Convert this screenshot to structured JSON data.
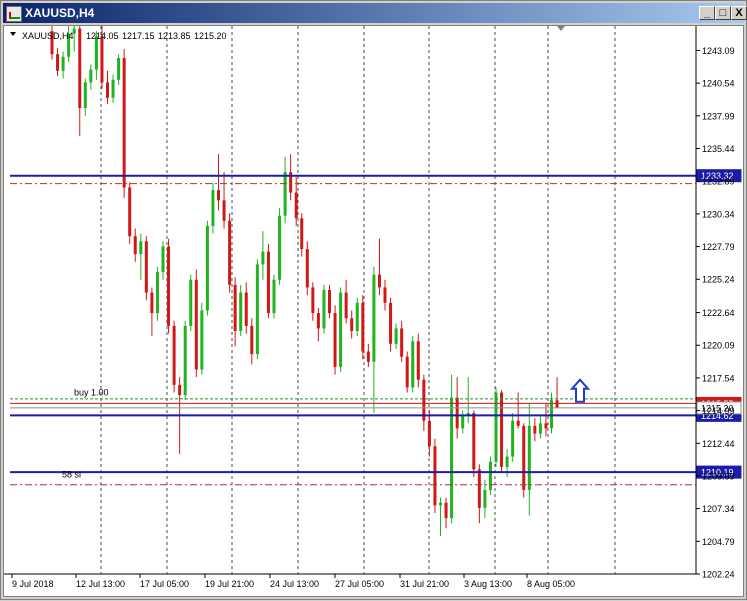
{
  "window": {
    "title": "XAUUSD,H4",
    "controls": {
      "minimize": "_",
      "maximize": "□",
      "close": "X"
    }
  },
  "colors": {
    "bull": "#1fb31f",
    "bear": "#d01818",
    "level_line": "#1c1ca8",
    "dashed_red": "#b03030",
    "vgrid": "#000000",
    "buy_line": "#2e8b2e",
    "arrow": "#1c3ccc"
  },
  "chart_data": {
    "type": "candlestick",
    "header": {
      "symbol": "XAUUSD,H4",
      "open": "1214.05",
      "high": "1217.15",
      "low": "1213.85",
      "close": "1215.20"
    },
    "ylim": [
      1202.24,
      1245.0
    ],
    "yticks": [
      "1243.09",
      "1240.54",
      "1237.99",
      "1235.44",
      "1232.89",
      "1230.34",
      "1227.79",
      "1225.24",
      "1222.64",
      "1220.09",
      "1217.54",
      "1214.99",
      "1212.44",
      "1209.89",
      "1207.34",
      "1204.79",
      "1202.24"
    ],
    "xticks": [
      "9 Jul 2018",
      "12 Jul 13:00",
      "17 Jul 05:00",
      "19 Jul 21:00",
      "24 Jul 13:00",
      "27 Jul 05:00",
      "31 Jul 21:00",
      "3 Aug 13:00",
      "8 Aug 05:00"
    ],
    "grid_vertical": true,
    "grid_horizontal": false,
    "horizontal_levels": [
      {
        "price": 1233.32,
        "label": "1233.32",
        "style": "solid",
        "role": "level"
      },
      {
        "price": 1214.62,
        "label": "1214.62",
        "style": "solid",
        "role": "level"
      },
      {
        "price": 1210.19,
        "label": "1210.19",
        "style": "solid",
        "role": "level"
      },
      {
        "price": 1215.55,
        "label": "1215.55",
        "style": "solid",
        "role": "ask"
      },
      {
        "price": 1215.2,
        "label": "1215.20",
        "style": "solid",
        "role": "bid"
      },
      {
        "price": 1232.7,
        "style": "dashdot",
        "role": "tp"
      },
      {
        "price": 1209.2,
        "style": "dashdot",
        "role": "sl"
      },
      {
        "price": 1215.9,
        "style": "dashed",
        "role": "buy"
      }
    ],
    "annotations": [
      {
        "text": "buy 1.00",
        "price": 1216.4
      },
      {
        "text": "58 sl",
        "price": 1210.0
      }
    ],
    "candles": [
      [
        1244.6,
        1245.2,
        1242.4,
        1242.8
      ],
      [
        1242.8,
        1243.3,
        1241.1,
        1241.5
      ],
      [
        1241.5,
        1243.0,
        1240.9,
        1242.6
      ],
      [
        1242.6,
        1245.0,
        1242.2,
        1244.4
      ],
      [
        1244.4,
        1245.0,
        1243.0,
        1244.8
      ],
      [
        1244.8,
        1245.0,
        1236.4,
        1238.6
      ],
      [
        1238.6,
        1240.9,
        1238.0,
        1240.6
      ],
      [
        1240.6,
        1242.0,
        1240.0,
        1241.6
      ],
      [
        1241.6,
        1244.6,
        1240.8,
        1244.2
      ],
      [
        1244.2,
        1245.0,
        1240.1,
        1240.6
      ],
      [
        1240.6,
        1241.5,
        1238.9,
        1239.4
      ],
      [
        1239.4,
        1241.2,
        1239.0,
        1240.8
      ],
      [
        1240.8,
        1242.8,
        1240.4,
        1242.5
      ],
      [
        1242.5,
        1243.2,
        1231.6,
        1232.4
      ],
      [
        1232.4,
        1232.8,
        1228.0,
        1228.6
      ],
      [
        1228.6,
        1229.2,
        1226.6,
        1227.2
      ],
      [
        1227.2,
        1228.8,
        1225.2,
        1228.2
      ],
      [
        1228.2,
        1228.6,
        1223.6,
        1224.2
      ],
      [
        1224.2,
        1224.6,
        1220.8,
        1222.6
      ],
      [
        1222.6,
        1226.2,
        1222.0,
        1225.8
      ],
      [
        1225.8,
        1228.2,
        1225.2,
        1227.8
      ],
      [
        1227.8,
        1228.4,
        1221.0,
        1221.6
      ],
      [
        1221.6,
        1222.0,
        1216.4,
        1217.0
      ],
      [
        1217.0,
        1217.6,
        1211.6,
        1216.2
      ],
      [
        1216.2,
        1222.0,
        1215.8,
        1221.6
      ],
      [
        1221.6,
        1225.6,
        1221.2,
        1225.2
      ],
      [
        1225.2,
        1226.0,
        1217.6,
        1218.2
      ],
      [
        1218.2,
        1223.4,
        1217.8,
        1222.8
      ],
      [
        1222.8,
        1229.8,
        1222.4,
        1229.4
      ],
      [
        1229.4,
        1232.8,
        1228.8,
        1232.2
      ],
      [
        1232.2,
        1235.0,
        1230.6,
        1231.4
      ],
      [
        1231.4,
        1233.6,
        1229.2,
        1229.8
      ],
      [
        1229.8,
        1230.4,
        1224.2,
        1224.8
      ],
      [
        1224.8,
        1225.4,
        1220.0,
        1221.2
      ],
      [
        1221.2,
        1224.8,
        1220.8,
        1224.2
      ],
      [
        1224.2,
        1225.0,
        1221.0,
        1221.6
      ],
      [
        1221.6,
        1222.2,
        1218.6,
        1219.4
      ],
      [
        1219.4,
        1226.8,
        1219.0,
        1226.4
      ],
      [
        1226.4,
        1229.0,
        1225.2,
        1227.4
      ],
      [
        1227.4,
        1228.0,
        1222.2,
        1222.6
      ],
      [
        1222.6,
        1225.6,
        1222.2,
        1225.2
      ],
      [
        1225.2,
        1230.8,
        1224.8,
        1230.2
      ],
      [
        1230.2,
        1234.8,
        1229.6,
        1233.6
      ],
      [
        1233.6,
        1235.0,
        1231.4,
        1232.0
      ],
      [
        1232.0,
        1233.2,
        1229.4,
        1230.0
      ],
      [
        1230.0,
        1230.4,
        1227.0,
        1227.6
      ],
      [
        1227.6,
        1228.2,
        1224.0,
        1224.6
      ],
      [
        1224.6,
        1225.0,
        1222.0,
        1222.6
      ],
      [
        1222.6,
        1223.0,
        1220.4,
        1221.4
      ],
      [
        1221.4,
        1224.8,
        1221.0,
        1224.4
      ],
      [
        1224.4,
        1224.8,
        1222.2,
        1222.6
      ],
      [
        1222.6,
        1223.2,
        1217.8,
        1218.4
      ],
      [
        1218.4,
        1224.6,
        1218.0,
        1224.2
      ],
      [
        1224.2,
        1225.2,
        1221.8,
        1222.2
      ],
      [
        1222.2,
        1222.8,
        1220.6,
        1221.2
      ],
      [
        1221.2,
        1223.8,
        1220.8,
        1223.4
      ],
      [
        1223.4,
        1224.0,
        1219.0,
        1219.6
      ],
      [
        1219.6,
        1220.2,
        1218.4,
        1218.8
      ],
      [
        1218.8,
        1226.2,
        1214.8,
        1225.6
      ],
      [
        1225.6,
        1228.4,
        1224.0,
        1224.6
      ],
      [
        1224.6,
        1225.2,
        1222.8,
        1223.4
      ],
      [
        1223.4,
        1223.8,
        1219.6,
        1220.2
      ],
      [
        1220.2,
        1221.8,
        1219.8,
        1221.4
      ],
      [
        1221.4,
        1222.0,
        1218.8,
        1219.2
      ],
      [
        1219.2,
        1219.6,
        1216.4,
        1216.8
      ],
      [
        1216.8,
        1220.8,
        1216.4,
        1220.4
      ],
      [
        1220.4,
        1221.0,
        1216.8,
        1217.4
      ],
      [
        1217.4,
        1217.8,
        1213.4,
        1214.2
      ],
      [
        1214.2,
        1215.0,
        1211.4,
        1212.2
      ],
      [
        1212.2,
        1212.8,
        1207.0,
        1207.6
      ],
      [
        1207.6,
        1208.2,
        1205.2,
        1207.8
      ],
      [
        1207.8,
        1208.2,
        1205.8,
        1206.6
      ],
      [
        1206.6,
        1217.8,
        1206.2,
        1216.0
      ],
      [
        1216.0,
        1217.6,
        1212.8,
        1213.6
      ],
      [
        1213.6,
        1215.0,
        1213.2,
        1214.6
      ],
      [
        1214.6,
        1217.6,
        1214.0,
        1214.8
      ],
      [
        1214.8,
        1215.0,
        1209.8,
        1210.4
      ],
      [
        1210.4,
        1210.8,
        1206.2,
        1207.4
      ],
      [
        1207.4,
        1209.6,
        1206.6,
        1208.8
      ],
      [
        1208.8,
        1211.4,
        1208.4,
        1211.0
      ],
      [
        1211.0,
        1216.8,
        1210.6,
        1216.4
      ],
      [
        1216.4,
        1216.6,
        1210.2,
        1210.6
      ],
      [
        1210.6,
        1212.0,
        1209.8,
        1211.4
      ],
      [
        1211.4,
        1214.8,
        1211.0,
        1214.2
      ],
      [
        1214.2,
        1216.4,
        1213.6,
        1213.8
      ],
      [
        1213.8,
        1214.0,
        1208.2,
        1208.8
      ],
      [
        1208.8,
        1215.6,
        1206.8,
        1213.8
      ],
      [
        1213.8,
        1214.4,
        1212.6,
        1213.2
      ],
      [
        1213.2,
        1214.6,
        1212.8,
        1214.0
      ],
      [
        1214.0,
        1215.6,
        1213.0,
        1213.6
      ],
      [
        1213.6,
        1216.4,
        1213.2,
        1215.8
      ],
      [
        1215.8,
        1217.6,
        1215.4,
        1215.2
      ]
    ]
  }
}
